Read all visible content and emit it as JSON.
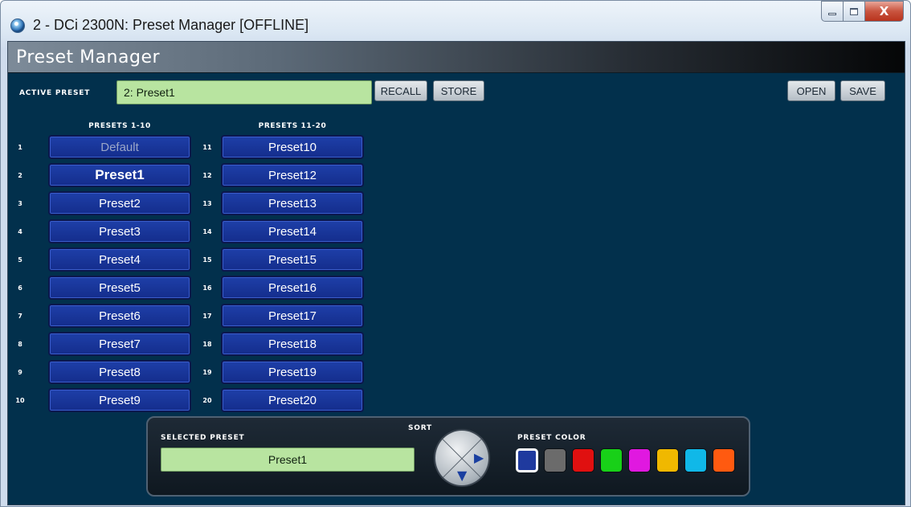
{
  "window": {
    "title": "2 - DCi 2300N: Preset Manager [OFFLINE]",
    "close_glyph": "X"
  },
  "header": {
    "title": "Preset Manager"
  },
  "active_preset": {
    "label": "ACTIVE PRESET",
    "value": "2: Preset1",
    "recall_label": "RECALL",
    "store_label": "STORE"
  },
  "file": {
    "open_label": "OPEN",
    "save_label": "SAVE"
  },
  "columns": {
    "left_title": "PRESETS 1-10",
    "right_title": "PRESETS 11-20",
    "left": [
      {
        "num": "1",
        "name": "Default"
      },
      {
        "num": "2",
        "name": "Preset1"
      },
      {
        "num": "3",
        "name": "Preset2"
      },
      {
        "num": "4",
        "name": "Preset3"
      },
      {
        "num": "5",
        "name": "Preset4"
      },
      {
        "num": "6",
        "name": "Preset5"
      },
      {
        "num": "7",
        "name": "Preset6"
      },
      {
        "num": "8",
        "name": "Preset7"
      },
      {
        "num": "9",
        "name": "Preset8"
      },
      {
        "num": "10",
        "name": "Preset9"
      }
    ],
    "right": [
      {
        "num": "11",
        "name": "Preset10"
      },
      {
        "num": "12",
        "name": "Preset12"
      },
      {
        "num": "13",
        "name": "Preset13"
      },
      {
        "num": "14",
        "name": "Preset14"
      },
      {
        "num": "15",
        "name": "Preset15"
      },
      {
        "num": "16",
        "name": "Preset16"
      },
      {
        "num": "17",
        "name": "Preset17"
      },
      {
        "num": "18",
        "name": "Preset18"
      },
      {
        "num": "19",
        "name": "Preset19"
      },
      {
        "num": "20",
        "name": "Preset20"
      }
    ]
  },
  "panel": {
    "selected_label": "SELECTED PRESET",
    "selected_value": "Preset1",
    "sort_label": "SORT",
    "color_label": "PRESET COLOR",
    "colors": [
      "#1f3a9e",
      "#6b6b6b",
      "#e01010",
      "#18d018",
      "#e018e0",
      "#f0b800",
      "#10b8e8",
      "#ff5a10"
    ],
    "selected_color_index": 0
  }
}
